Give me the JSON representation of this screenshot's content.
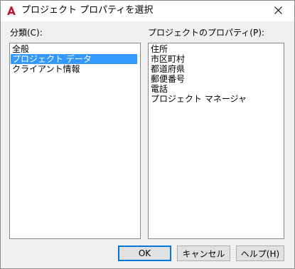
{
  "window": {
    "title": "プロジェクト プロパティを選択",
    "close_icon": "close-icon",
    "app_icon": "autocad-logo-icon",
    "accent_color": "#c8102e"
  },
  "categories": {
    "label": "分類(C):",
    "items": [
      {
        "label": "全般",
        "selected": false
      },
      {
        "label": "プロジェクト データ",
        "selected": true
      },
      {
        "label": "クライアント情報",
        "selected": false
      }
    ]
  },
  "properties": {
    "label": "プロジェクトのプロパティ(P):",
    "items": [
      {
        "label": "住所"
      },
      {
        "label": "市区町村"
      },
      {
        "label": "都道府県"
      },
      {
        "label": "郵便番号"
      },
      {
        "label": "電話"
      },
      {
        "label": "プロジェクト マネージャ"
      }
    ]
  },
  "buttons": {
    "ok": "OK",
    "cancel": "キャンセル",
    "help": "ヘルプ(H)"
  }
}
